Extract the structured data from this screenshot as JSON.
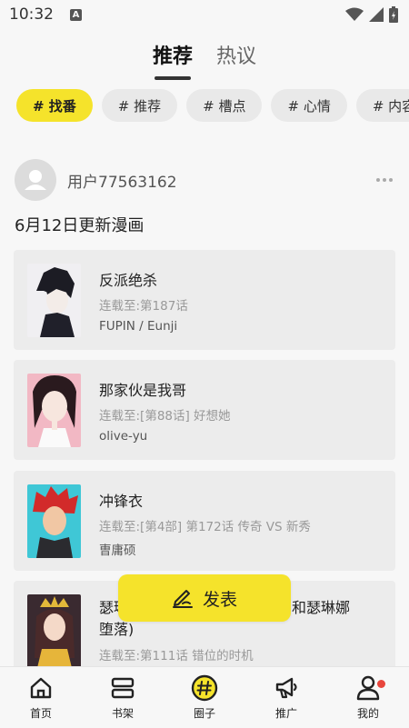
{
  "status": {
    "time": "10:32",
    "a_icon": "A"
  },
  "top_tabs": [
    {
      "label": "推荐",
      "active": true
    },
    {
      "label": "热议",
      "active": false
    }
  ],
  "chips": [
    {
      "label": "# 找番",
      "active": true
    },
    {
      "label": "# 推荐",
      "active": false
    },
    {
      "label": "# 槽点",
      "active": false
    },
    {
      "label": "# 心情",
      "active": false
    },
    {
      "label": "# 内容",
      "active": false
    }
  ],
  "post": {
    "username": "用户77563162",
    "text": "6月12日更新漫画"
  },
  "comics": [
    {
      "title": "反派绝杀",
      "episode": "连载至:第187话",
      "author": "FUPIN / Eunji"
    },
    {
      "title": "那家伙是我哥",
      "episode": "连载至:[第88话] 好想她",
      "author": "olive-yu"
    },
    {
      "title": "冲锋衣",
      "episode": "连载至:[第4部] 第172话 传奇 VS 新秀",
      "author": "曺庸硕"
    },
    {
      "title_part1": "瑟琳",
      "title_part2": "和瑟琳娜",
      "title_line2": "堕落)",
      "episode": "连载至:第111话 错位的时机"
    }
  ],
  "publish_label": "发表",
  "nav": [
    {
      "label": "首页",
      "icon": "home-icon"
    },
    {
      "label": "书架",
      "icon": "bookshelf-icon"
    },
    {
      "label": "圈子",
      "icon": "circle-hash-icon"
    },
    {
      "label": "推广",
      "icon": "megaphone-icon"
    },
    {
      "label": "我的",
      "icon": "user-icon"
    }
  ],
  "colors": {
    "accent": "#f5e32b",
    "badge": "#e8463c",
    "card_bg": "#ececec"
  }
}
